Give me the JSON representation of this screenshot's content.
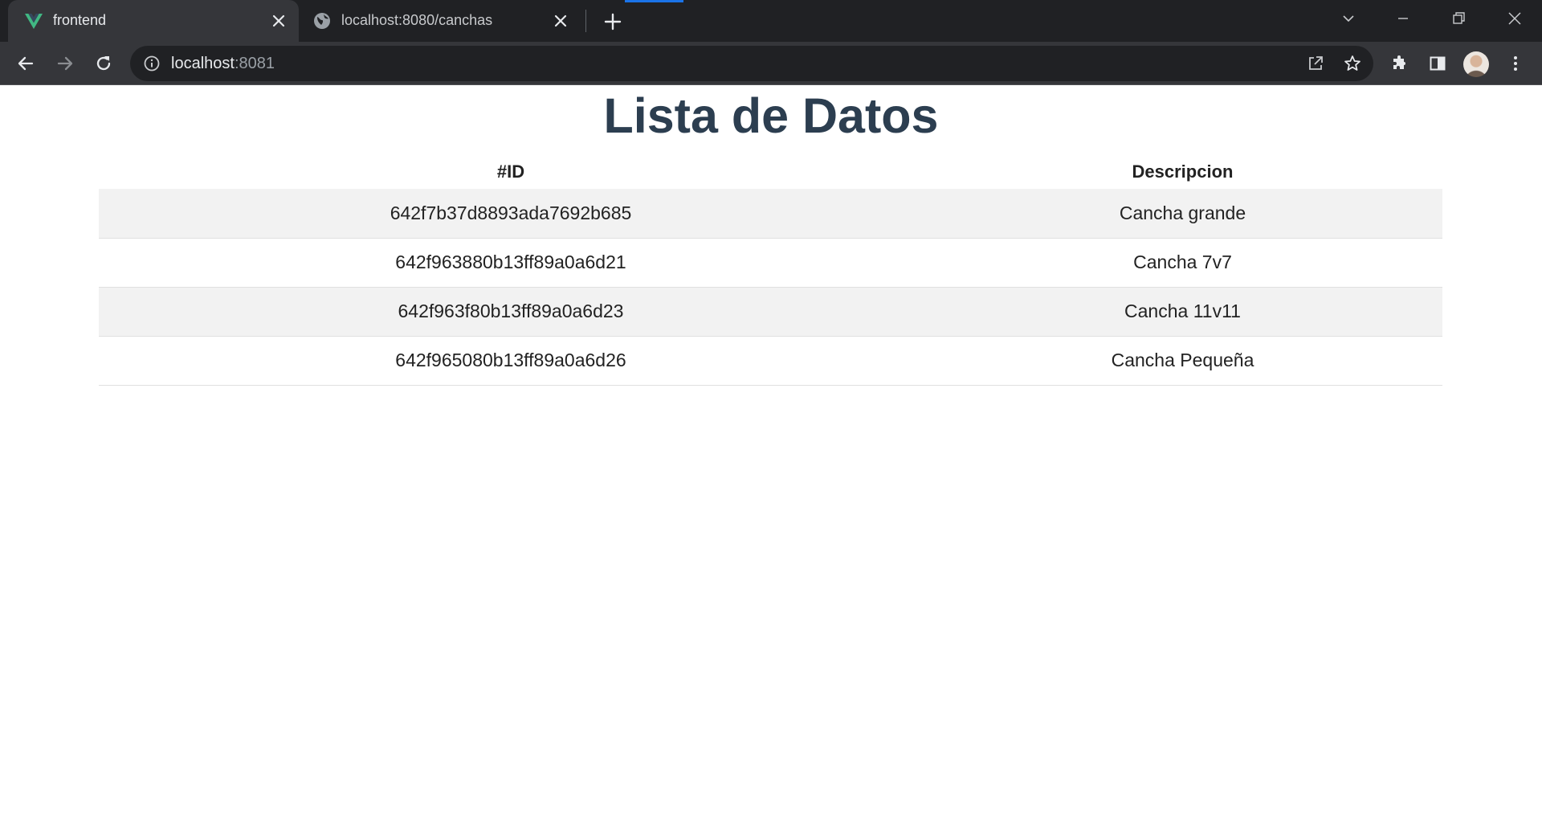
{
  "browser": {
    "tabs": [
      {
        "title": "frontend",
        "icon": "vue-logo-icon",
        "active": true
      },
      {
        "title": "localhost:8080/canchas",
        "icon": "globe-icon",
        "active": false
      }
    ],
    "address": {
      "host": "localhost",
      "port": ":8081"
    },
    "colors": {
      "tabstrip": "#202124",
      "toolbar": "#35363a",
      "accent": "#1a73e8",
      "vue_green": "#41b883"
    }
  },
  "page": {
    "title": "Lista de Datos",
    "table": {
      "headers": {
        "id": "#ID",
        "description": "Descripcion"
      },
      "rows": [
        {
          "id": "642f7b37d8893ada7692b685",
          "description": "Cancha grande"
        },
        {
          "id": "642f963880b13ff89a0a6d21",
          "description": "Cancha 7v7"
        },
        {
          "id": "642f963f80b13ff89a0a6d23",
          "description": "Cancha 11v11"
        },
        {
          "id": "642f965080b13ff89a0a6d26",
          "description": "Cancha Pequeña"
        }
      ]
    },
    "colors": {
      "title": "#2c3e50",
      "stripe": "#f2f2f2"
    }
  }
}
